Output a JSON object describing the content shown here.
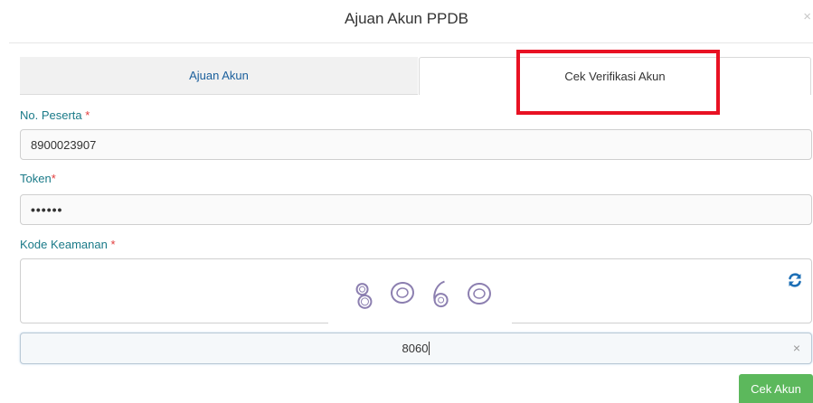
{
  "modal": {
    "title": "Ajuan Akun PPDB",
    "close_label": "×"
  },
  "tabs": [
    {
      "label": "Ajuan Akun",
      "active": false
    },
    {
      "label": "Cek Verifikasi Akun",
      "active": true
    }
  ],
  "form": {
    "no_peserta": {
      "label": "No. Peserta ",
      "required_mark": "*",
      "value": "8900023907"
    },
    "token": {
      "label": "Token",
      "required_mark": "*",
      "value": "••••••"
    },
    "kode_keamanan": {
      "label": "Kode Keamanan ",
      "required_mark": "*",
      "captcha_icon": "refresh-icon"
    },
    "code_input": {
      "value": "8060",
      "clear_label": "×"
    }
  },
  "submit": {
    "label": "Cek Akun"
  },
  "colors": {
    "label": "#1a7a88",
    "required": "#e23b3b",
    "button": "#5cb85c",
    "highlight": "#e81123",
    "tab_link": "#1a5f9c"
  }
}
